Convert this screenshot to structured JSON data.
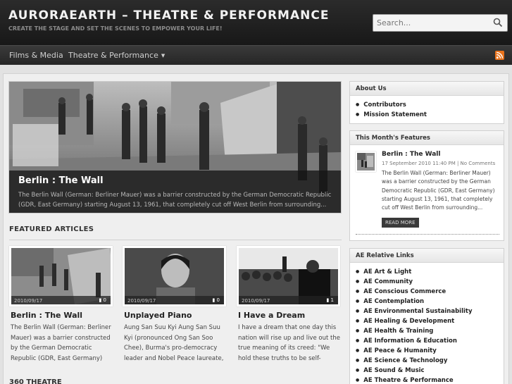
{
  "header": {
    "site_title": "AURORAEARTH – THEATRE & PERFORMANCE",
    "tagline": "CREATE THE STAGE AND SET THE SCENES TO EMPOWER YOUR LIFE!",
    "search_placeholder": "Search..."
  },
  "nav": {
    "items": [
      {
        "label": "Films & Media"
      },
      {
        "label": "Theatre & Performance"
      }
    ],
    "dropdown_caret": "▼"
  },
  "slider": {
    "title": "Berlin : The Wall",
    "excerpt": "The Berlin Wall (German: Berliner Mauer) was a barrier constructed by the German Democratic Republic (GDR, East Germany) starting August 13, 1961, that completely cut off West Berlin from surrounding..."
  },
  "featured": {
    "heading": "FEATURED ARTICLES",
    "articles": [
      {
        "title": "Berlin : The Wall",
        "date": "2010/09/17",
        "comments": "0",
        "excerpt": "The Berlin Wall (German: Berliner Mauer) was a barrier constructed by the German Democratic Republic (GDR, East Germany) starting"
      },
      {
        "title": "Unplayed Piano",
        "date": "2010/09/17",
        "comments": "0",
        "excerpt": "Aung San Suu Kyi Aung San Suu Kyi (pronounced Ong San Soo Chee), Burma's pro-democracy leader and Nobel Peace laureate,"
      },
      {
        "title": "I Have a Dream",
        "date": "2010/09/17",
        "comments": "1",
        "excerpt": "I have a dream that one day this nation will rise up and live out the true meaning of its creed: \"We hold these truths to be self-evident, that"
      }
    ]
  },
  "next_section": "360 THEATRE",
  "sidebar": {
    "about": {
      "heading": "About Us",
      "items": [
        "Contributors",
        "Mission Statement"
      ]
    },
    "month": {
      "heading": "This Month's Features",
      "title": "Berlin : The Wall",
      "meta": "17 September 2010 11:40 PM | No Comments",
      "text": "The Berlin Wall (German: Berliner Mauer) was a barrier constructed by the German Democratic Republic (GDR, East Germany) starting August 13, 1961, that completely cut off West Berlin from surrounding...",
      "read_more": "READ MORE"
    },
    "links": {
      "heading": "AE Relative Links",
      "items": [
        "AE Art & Light",
        "AE Community",
        "AE Conscious Commerce",
        "AE Contemplation",
        "AE Environmental Sustainability",
        "AE Healing & Development",
        "AE Health & Training",
        "AE Information & Education",
        "AE Peace & Humanity",
        "AE Science & Technology",
        "AE Sound & Music",
        "AE Theatre & Performance"
      ]
    }
  },
  "icons": {
    "search": "search-icon",
    "rss": "rss-icon",
    "comment": "comment-icon"
  },
  "colors": {
    "header_bg": "#1f1f1f",
    "nav_bg": "#2e2e2e",
    "rss": "#e8721c",
    "page_bg": "#efefef"
  }
}
